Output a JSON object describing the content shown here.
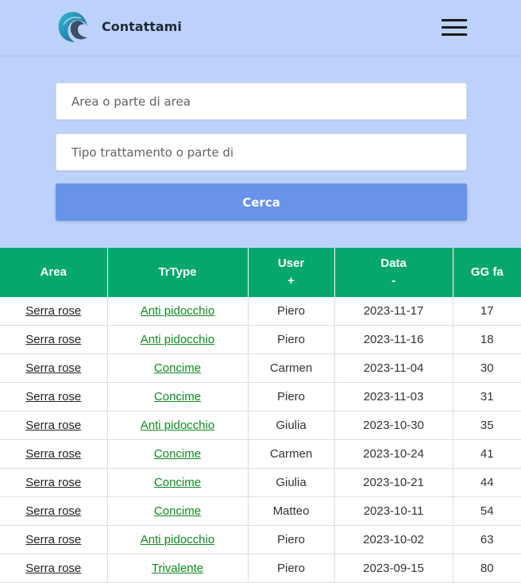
{
  "header": {
    "brand": "Contattami",
    "logo_icon": "wave-logo-icon",
    "menu_icon": "hamburger-menu-icon"
  },
  "search": {
    "area_placeholder": "Area o parte di area",
    "type_placeholder": "Tipo trattamento o parte di",
    "button_label": "Cerca"
  },
  "table": {
    "headers": {
      "area": "Area",
      "trtype": "TrType",
      "user": "User",
      "user_sort": "+",
      "data": "Data",
      "data_sort": "-",
      "ggfa": "GG fa"
    },
    "rows": [
      {
        "area": "Serra rose",
        "trtype": "Anti pidocchio",
        "user": "Piero",
        "data": "2023-11-17",
        "gg": "17"
      },
      {
        "area": "Serra rose",
        "trtype": "Anti pidocchio",
        "user": "Piero",
        "data": "2023-11-16",
        "gg": "18"
      },
      {
        "area": "Serra rose",
        "trtype": "Concime",
        "user": "Carmen",
        "data": "2023-11-04",
        "gg": "30"
      },
      {
        "area": "Serra rose",
        "trtype": "Concime",
        "user": "Piero",
        "data": "2023-11-03",
        "gg": "31"
      },
      {
        "area": "Serra rose",
        "trtype": "Anti pidocchio",
        "user": "Giulia",
        "data": "2023-10-30",
        "gg": "35"
      },
      {
        "area": "Serra rose",
        "trtype": "Concime",
        "user": "Carmen",
        "data": "2023-10-24",
        "gg": "41"
      },
      {
        "area": "Serra rose",
        "trtype": "Concime",
        "user": "Giulia",
        "data": "2023-10-21",
        "gg": "44"
      },
      {
        "area": "Serra rose",
        "trtype": "Concime",
        "user": "Matteo",
        "data": "2023-10-11",
        "gg": "54"
      },
      {
        "area": "Serra rose",
        "trtype": "Anti pidocchio",
        "user": "Piero",
        "data": "2023-10-02",
        "gg": "63"
      },
      {
        "area": "Serra rose",
        "trtype": "Trivalente",
        "user": "Piero",
        "data": "2023-09-15",
        "gg": "80"
      }
    ]
  },
  "colors": {
    "header_bg": "#bdd2fa",
    "button_bg": "#6893e9",
    "table_header_bg": "#05a86a",
    "trtype_link": "#0f8a1f"
  }
}
